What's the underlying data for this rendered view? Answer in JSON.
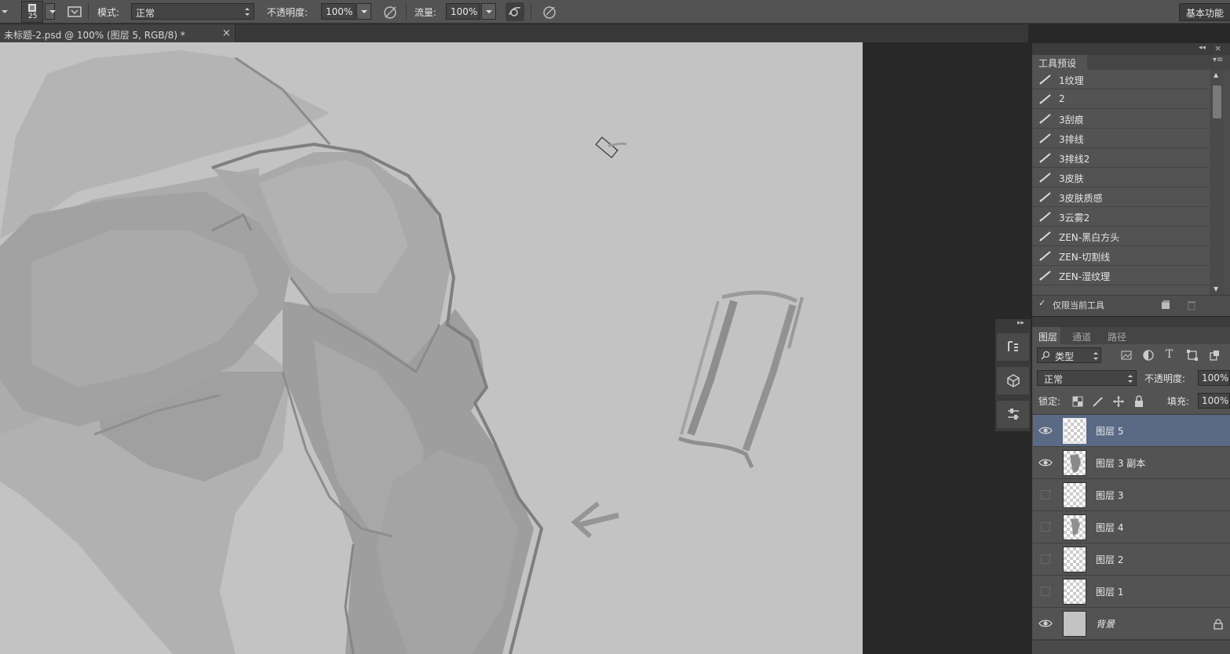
{
  "options_bar": {
    "brush_size": "25",
    "mode_label": "模式:",
    "mode_value": "正常",
    "opacity_label": "不透明度:",
    "opacity_value": "100%",
    "flow_label": "流量:",
    "flow_value": "100%",
    "workspace_button": "基本功能"
  },
  "document": {
    "tab_title": "未标题-2.psd @ 100% (图层 5, RGB/8) *",
    "close_glyph": "×"
  },
  "tool_presets": {
    "title": "工具预设",
    "items": [
      "1纹理",
      "2",
      "3刮痕",
      "3排线",
      "3排线2",
      "3皮肤",
      "3皮肤质感",
      "3云雾2",
      "ZEN-黑白方头",
      "ZEN-切割线",
      "ZEN-湿纹理"
    ],
    "current_tool_only_label": "仅限当前工具",
    "checkbox_mark": "✓"
  },
  "layers_panel": {
    "tabs": [
      "图层",
      "通道",
      "路径"
    ],
    "filter_label": "类型",
    "blend_mode": "正常",
    "opacity_label": "不透明度:",
    "opacity_value": "100%",
    "lock_label": "锁定:",
    "fill_label": "填充:",
    "fill_value": "100%",
    "layers": [
      {
        "name": "图层 5",
        "visible": true,
        "selected": true
      },
      {
        "name": "图层 3 副本",
        "visible": true,
        "selected": false
      },
      {
        "name": "图层 3",
        "visible": false,
        "selected": false
      },
      {
        "name": "图层 4",
        "visible": false,
        "selected": false
      },
      {
        "name": "图层 2",
        "visible": false,
        "selected": false
      },
      {
        "name": "图层 1",
        "visible": false,
        "selected": false
      },
      {
        "name": "背景",
        "visible": true,
        "selected": false,
        "locked": true
      }
    ]
  },
  "colors": {
    "canvas_bg": "#c3c3c3",
    "panel_bg": "#535353",
    "selected_layer": "#5a6a85",
    "app_bg": "#282828"
  }
}
